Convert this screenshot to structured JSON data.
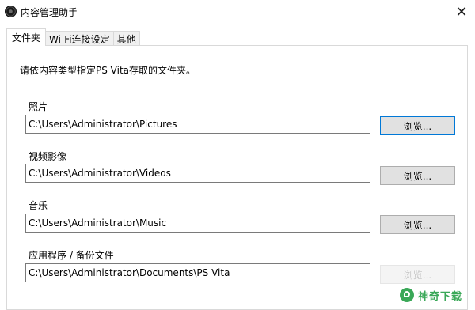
{
  "window": {
    "title": "内容管理助手",
    "close_glyph": "✕"
  },
  "tabs": [
    {
      "label": "文件夹",
      "active": true
    },
    {
      "label": "Wi-Fi连接设定",
      "active": false
    },
    {
      "label": "其他",
      "active": false
    }
  ],
  "instruction": "请依内容类型指定PS Vita存取的文件夹。",
  "fields": [
    {
      "label": "照片",
      "path": "C:\\Users\\Administrator\\Pictures",
      "button": "浏览..."
    },
    {
      "label": "视频影像",
      "path": "C:\\Users\\Administrator\\Videos",
      "button": "浏览..."
    },
    {
      "label": "音乐",
      "path": "C:\\Users\\Administrator\\Music",
      "button": "浏览..."
    },
    {
      "label": "应用程序 / 备份文件",
      "path": "C:\\Users\\Administrator\\Documents\\PS Vita",
      "button": "浏览..."
    }
  ],
  "watermark": {
    "text": "神奇下载",
    "color": "#2aa14a"
  }
}
